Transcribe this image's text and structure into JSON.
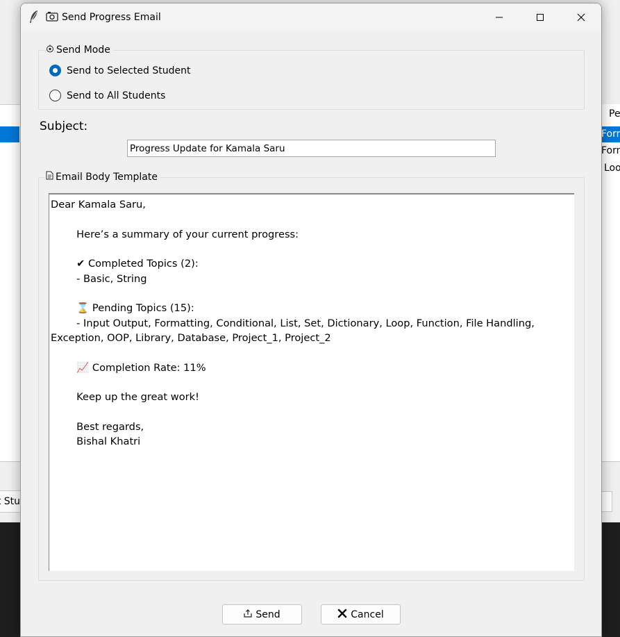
{
  "background_app": {
    "right_header": "Pe",
    "right_rows": [
      "Form",
      "Form",
      "Loo"
    ],
    "left_button_label": "t Stu"
  },
  "dialog": {
    "title": "Send Progress Email",
    "title_icons": [
      "feather-icon",
      "camera-icon"
    ],
    "window_controls": [
      "minimize",
      "maximize",
      "close"
    ],
    "send_mode": {
      "legend": "Send Mode",
      "legend_icon": "target-icon",
      "options": [
        {
          "label": "Send to Selected Student",
          "checked": true
        },
        {
          "label": "Send to All Students",
          "checked": false
        }
      ]
    },
    "subject": {
      "label": "Subject:",
      "value": "Progress Update for Kamala Saru"
    },
    "email_body": {
      "legend": "Email Body Template",
      "legend_icon": "memo-icon",
      "text": "Dear Kamala Saru,\n\n        Here’s a summary of your current progress:\n\n        ✔ Completed Topics (2):\n        - Basic, String\n\n        ⌛ Pending Topics (15):\n        - Input Output, Formatting, Conditional, List, Set, Dictionary, Loop, Function, File Handling, Exception, OOP, Library, Database, Project_1, Project_2\n\n        📈 Completion Rate: 11%\n\n        Keep up the great work!\n\n        Best regards,\n        Bishal Khatri"
    },
    "buttons": {
      "send": "Send",
      "send_icon": "outbox-icon",
      "cancel": "Cancel",
      "cancel_icon": "x-icon"
    }
  },
  "colors": {
    "accent": "#0067c0",
    "selection": "#0078d7",
    "dialog_bg": "#f0f0f0"
  }
}
